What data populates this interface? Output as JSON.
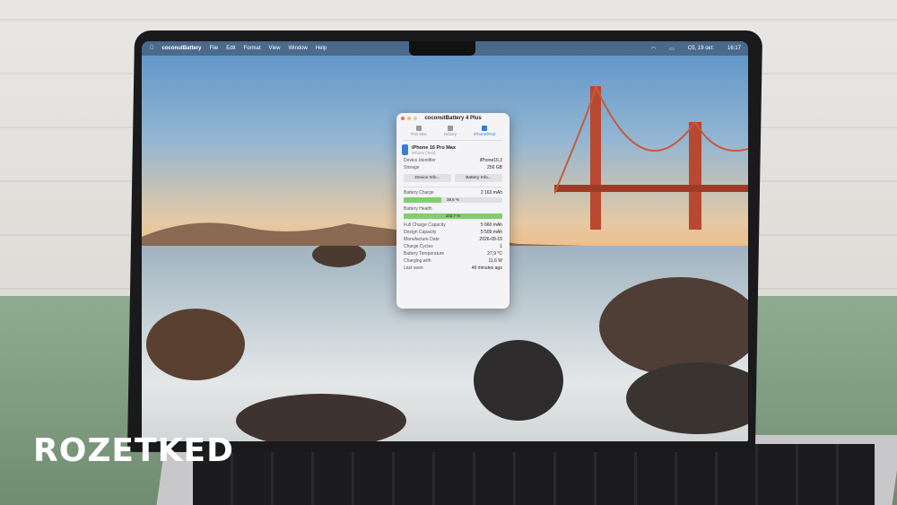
{
  "menubar": {
    "app": "coconutBattery",
    "items": [
      "File",
      "Edit",
      "Format",
      "View",
      "Window",
      "Help"
    ],
    "date": "Сб, 19 окт.",
    "time": "16:17"
  },
  "window": {
    "title": "coconutBattery 4 Plus",
    "tabs": [
      {
        "label": "This Mac"
      },
      {
        "label": "History"
      },
      {
        "label": "iPhone/iPad"
      }
    ],
    "device": {
      "name": "iPhone 16 Pro Max",
      "sub": "iPhone (Test)"
    },
    "identifier": {
      "label": "Device Identifier",
      "value": "iPhone16,3"
    },
    "storage": {
      "label": "Storage",
      "value": "256 GB"
    },
    "buttons": {
      "device_info": "Device Info...",
      "battery_info": "Battery Info..."
    },
    "charge": {
      "label": "Battery Charge",
      "value": "2 163 mAh",
      "bar_label": "38,6 %",
      "fraction": 0.386
    },
    "health": {
      "label": "Battery Health",
      "bar_label": "102,7 %",
      "fraction": 1.0
    },
    "rows": [
      {
        "k": "Full Charge Capacity",
        "v": "5 660 mAh"
      },
      {
        "k": "Design Capacity",
        "v": "5 509 mAh"
      },
      {
        "k": "Manufacture Date",
        "v": "2026-09-15"
      },
      {
        "k": "Charge Cycles",
        "v": "1"
      },
      {
        "k": "Battery Temperature",
        "v": "27,9 °C"
      },
      {
        "k": "Charging with",
        "v": "11,6 W"
      },
      {
        "k": "Last seen",
        "v": "46 minutes ago"
      }
    ]
  },
  "watermark": "ROZETKED",
  "colors": {
    "accent": "#2c7be5",
    "bar_green": "#7fcf6f"
  }
}
